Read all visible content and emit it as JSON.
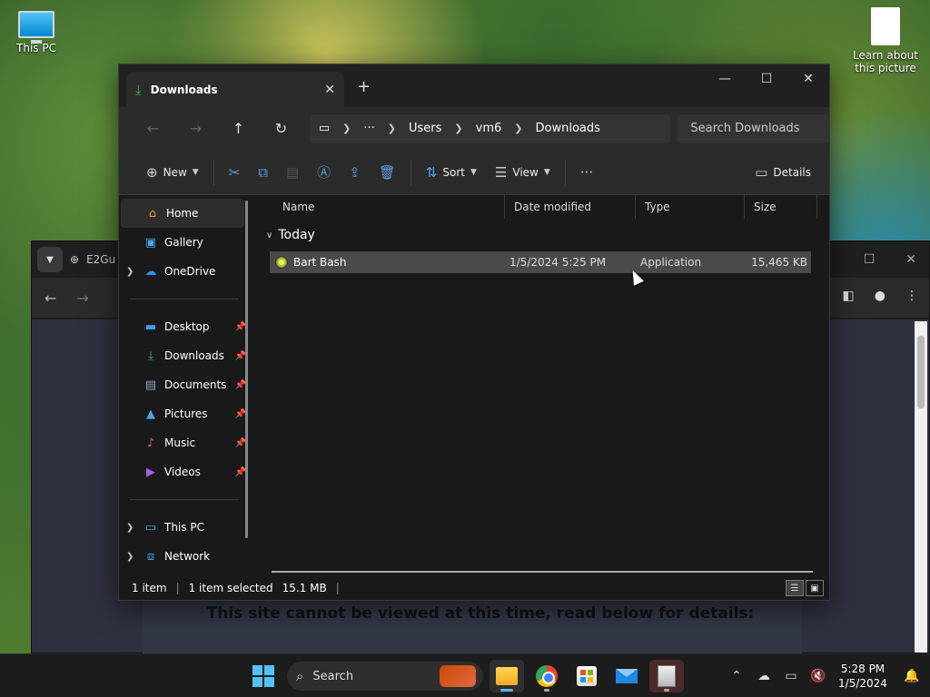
{
  "desktop": {
    "icons": [
      {
        "label": "This PC"
      },
      {
        "label": "Learn about this picture"
      }
    ]
  },
  "browser": {
    "tab_title": "E2Gu",
    "site_message": "This site cannot be viewed at this time, read below for details:"
  },
  "explorer": {
    "tab_title": "Downloads",
    "address": [
      "Users",
      "vm6",
      "Downloads"
    ],
    "search_placeholder": "Search Downloads",
    "commands": {
      "new": "New",
      "sort": "Sort",
      "view": "View",
      "details": "Details"
    },
    "sidebar": {
      "top": [
        {
          "label": "Home",
          "active": true
        },
        {
          "label": "Gallery"
        },
        {
          "label": "OneDrive"
        }
      ],
      "pinned": [
        {
          "label": "Desktop"
        },
        {
          "label": "Downloads"
        },
        {
          "label": "Documents"
        },
        {
          "label": "Pictures"
        },
        {
          "label": "Music"
        },
        {
          "label": "Videos"
        }
      ],
      "bottom": [
        {
          "label": "This PC"
        },
        {
          "label": "Network"
        }
      ]
    },
    "columns": {
      "name": "Name",
      "date": "Date modified",
      "type": "Type",
      "size": "Size"
    },
    "group": "Today",
    "files": [
      {
        "name": "Bart Bash",
        "date": "1/5/2024 5:25 PM",
        "type": "Application",
        "size": "15,465 KB"
      }
    ],
    "status": {
      "count": "1 item",
      "selected": "1 item selected",
      "size": "15.1 MB"
    }
  },
  "taskbar": {
    "search_label": "Search",
    "time": "5:28 PM",
    "date": "1/5/2024"
  }
}
